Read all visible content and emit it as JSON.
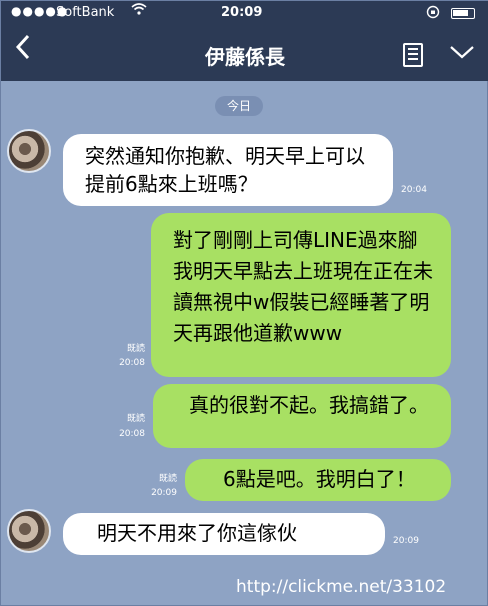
{
  "status_bar": {
    "signal": "●●●●●",
    "carrier": "SoftBank",
    "wifi_icon": "wifi-icon",
    "time": "20:09",
    "lock_icon": "rotation-lock-icon",
    "battery_icon": "battery-icon"
  },
  "nav": {
    "back_icon": "chevron-left-icon",
    "title": "伊藤係長",
    "notes_icon": "notes-icon",
    "menu_icon": "chevron-down-icon"
  },
  "date_divider": "今日",
  "messages": [
    {
      "side": "received",
      "text": "突然通知你抱歉、明天早上可以提前6點來上班嗎？",
      "time": "20:04"
    },
    {
      "side": "sent",
      "read": "既読",
      "text": "對了剛剛上司傳LINE過來腳我明天早點去上班現在正在未讀無視中w假裝已經睡著了明天再跟他道歉www",
      "time": "20:08"
    },
    {
      "side": "sent",
      "read": "既読",
      "text": "真的很對不起。我搞錯了。",
      "time": "20:08"
    },
    {
      "side": "sent",
      "read": "既読",
      "text": "6點是吧。我明白了！",
      "time": "20:09"
    },
    {
      "side": "received",
      "text": "明天不用來了你這傢伙",
      "time": "20:09"
    }
  ],
  "watermark": "http://clickme.net/33102",
  "colors": {
    "nav": "#2c3a55",
    "background": "#8ea3c4",
    "sent_bubble": "#a8e063",
    "received_bubble": "#ffffff"
  }
}
